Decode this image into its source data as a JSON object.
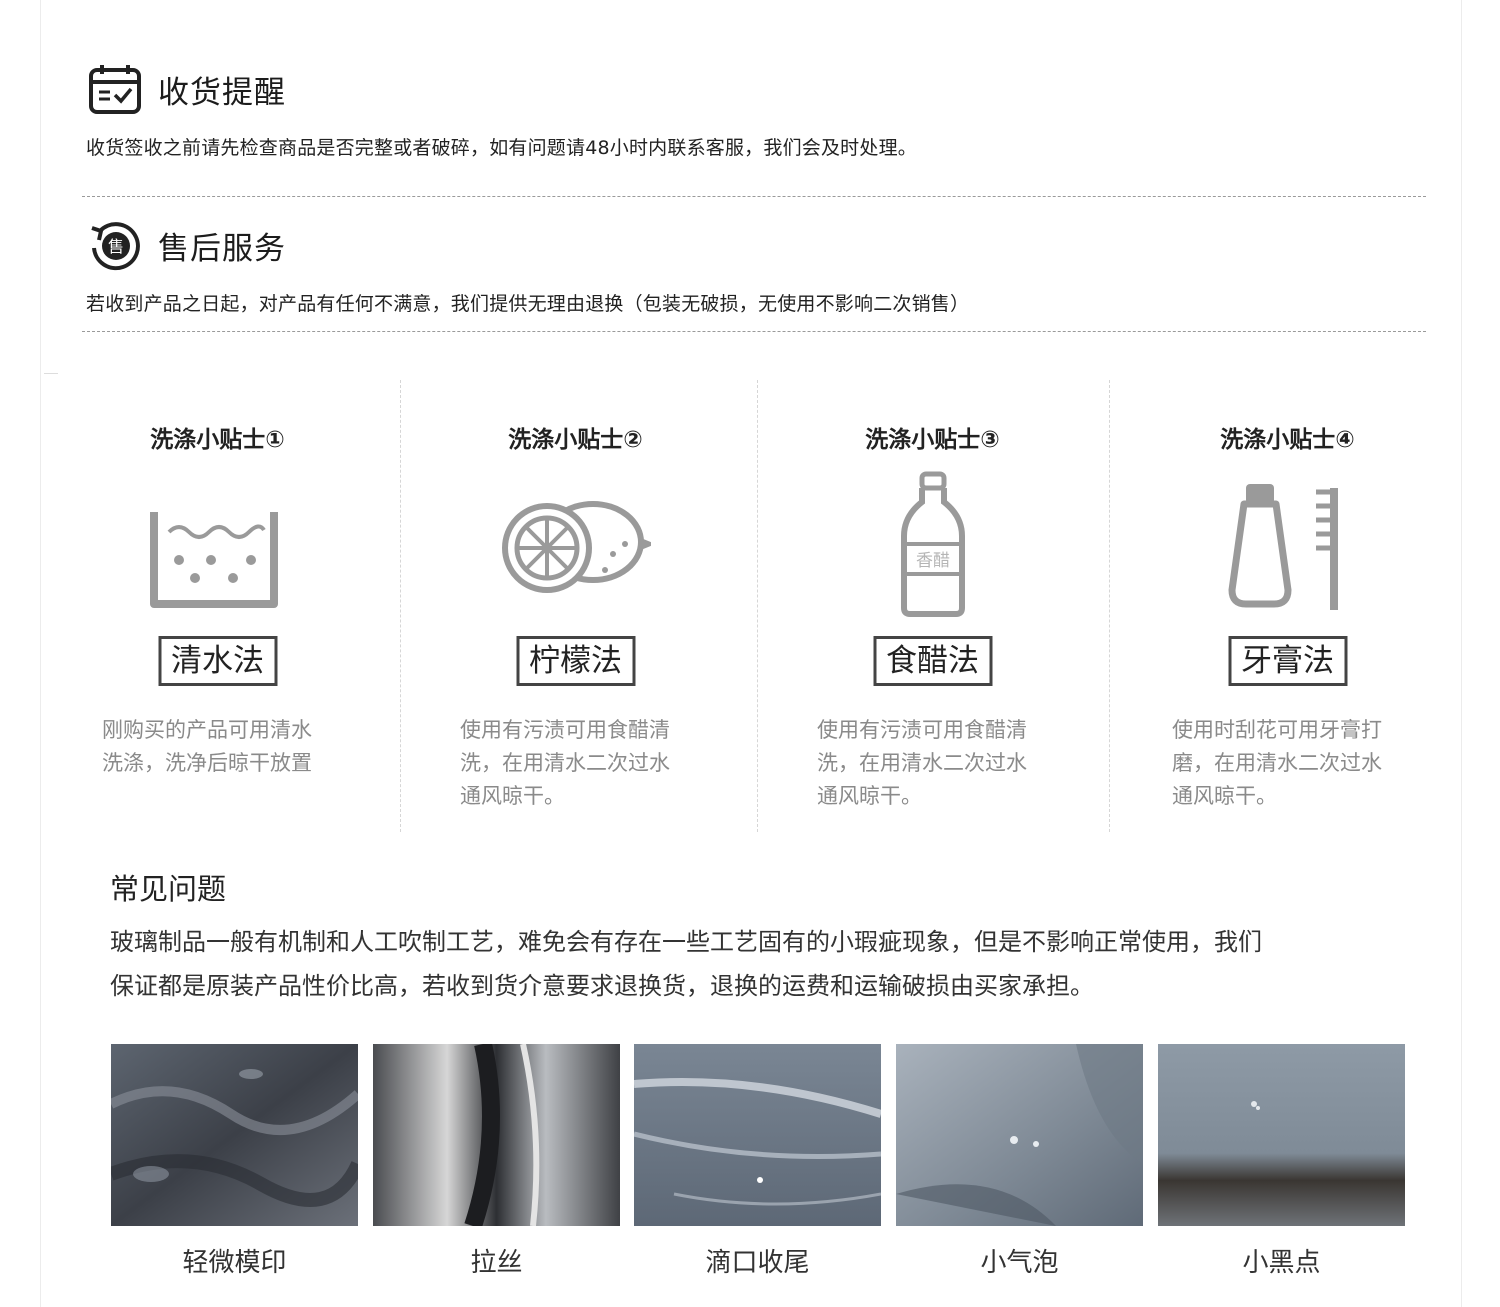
{
  "receipt": {
    "title": "收货提醒",
    "text": "收货签收之前请先检查商品是否完整或者破碎，如有问题请48小时内联系客服，我们会及时处理。"
  },
  "after_sales": {
    "title": "售后服务",
    "icon_char": "售",
    "text": "若收到产品之日起，对产品有任何不满意，我们提供无理由退换（包装无破损，无使用不影响二次销售）"
  },
  "tips": [
    {
      "title": "洗涤小贴士①",
      "icon": "water-basin-icon",
      "method": "清水法",
      "desc": [
        "刚购买的产品可用清水",
        "洗涤，洗净后晾干放置"
      ]
    },
    {
      "title": "洗涤小贴士②",
      "icon": "lemon-icon",
      "method": "柠檬法",
      "desc": [
        "使用有污渍可用食醋清",
        "洗，在用清水二次过水",
        "通风晾干。"
      ]
    },
    {
      "title": "洗涤小贴士③",
      "icon": "vinegar-bottle-icon",
      "bottle_label": "香醋",
      "method": "食醋法",
      "desc": [
        "使用有污渍可用食醋清",
        "洗，在用清水二次过水",
        "通风晾干。"
      ]
    },
    {
      "title": "洗涤小贴士④",
      "icon": "toothpaste-brush-icon",
      "method": "牙膏法",
      "desc": [
        "使用时刮花可用牙膏打",
        "磨，在用清水二次过水",
        "通风晾干。"
      ]
    }
  ],
  "faq": {
    "title": "常见问题",
    "lines": [
      "玻璃制品一般有机制和人工吹制工艺，难免会有存在一些工艺固有的小瑕疵现象，但是不影响正常使用，我们",
      "保证都是原装产品性价比高，若收到货介意要求退换货，退换的运费和运输破损由买家承担。"
    ]
  },
  "defects": [
    {
      "caption": "轻微模印"
    },
    {
      "caption": "拉丝"
    },
    {
      "caption": "滴口收尾"
    },
    {
      "caption": "小气泡"
    },
    {
      "caption": "小黑点"
    }
  ],
  "colors": {
    "icon_gray": "#9a9a9a",
    "text_gray": "#8a8a8a",
    "dark": "#222222"
  }
}
